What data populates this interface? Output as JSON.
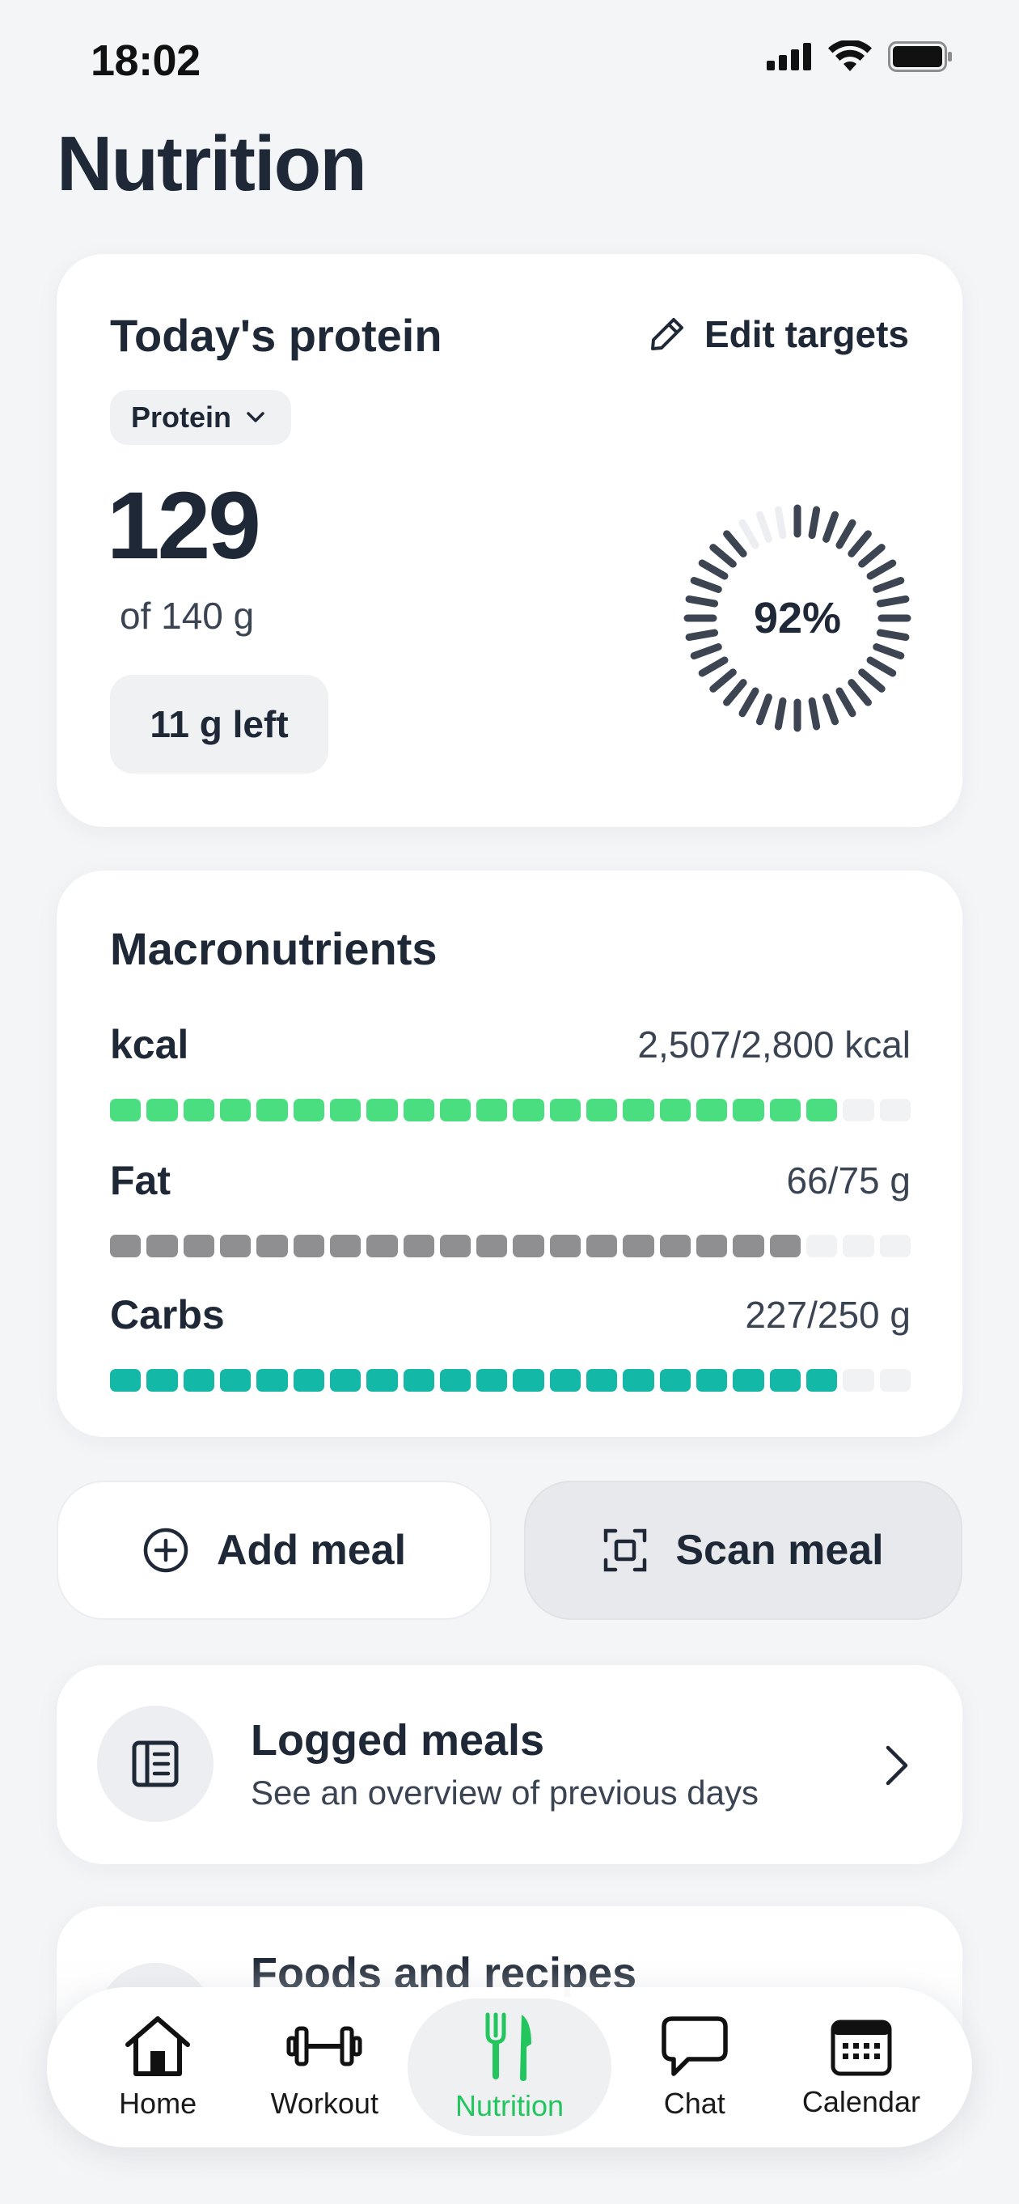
{
  "status_bar": {
    "time": "18:02",
    "signal_icon": "cellular-signal-icon",
    "wifi_icon": "wifi-icon",
    "battery_icon": "battery-icon"
  },
  "page": {
    "title": "Nutrition"
  },
  "protein_card": {
    "title": "Today's protein",
    "edit_label": "Edit targets",
    "edit_icon": "pencil-icon",
    "selector_label": "Protein",
    "value": "129",
    "target": "of 140 g",
    "remaining": "11 g left",
    "progress_label": "92%",
    "progress": 0.92
  },
  "macros": {
    "title": "Macronutrients",
    "items": [
      {
        "name": "kcal",
        "amount": "2,507/2,800 kcal",
        "progress": 0.9,
        "color": "#4ade80"
      },
      {
        "name": "Fat",
        "amount": "66/75 g",
        "progress": 0.88,
        "color": "#8f8f92"
      },
      {
        "name": "Carbs",
        "amount": "227/250 g",
        "progress": 0.9,
        "color": "#14b8a6"
      }
    ]
  },
  "actions": {
    "add_label": "Add meal",
    "scan_label": "Scan meal"
  },
  "logged_meals": {
    "title": "Logged meals",
    "subtitle": "See an overview of previous days"
  },
  "foods": {
    "title": "Foods and recipes"
  },
  "tabs": [
    {
      "label": "Home",
      "icon": "house-icon"
    },
    {
      "label": "Workout",
      "icon": "dumbbell-icon"
    },
    {
      "label": "Nutrition",
      "icon": "fork-knife-icon",
      "active": true
    },
    {
      "label": "Chat",
      "icon": "chat-bubble-icon"
    },
    {
      "label": "Calendar",
      "icon": "calendar-icon"
    }
  ],
  "colors": {
    "accent_green": "#22c55e",
    "text": "#1e2836",
    "ring": "#3d4552",
    "ring_track": "#eceef1"
  }
}
